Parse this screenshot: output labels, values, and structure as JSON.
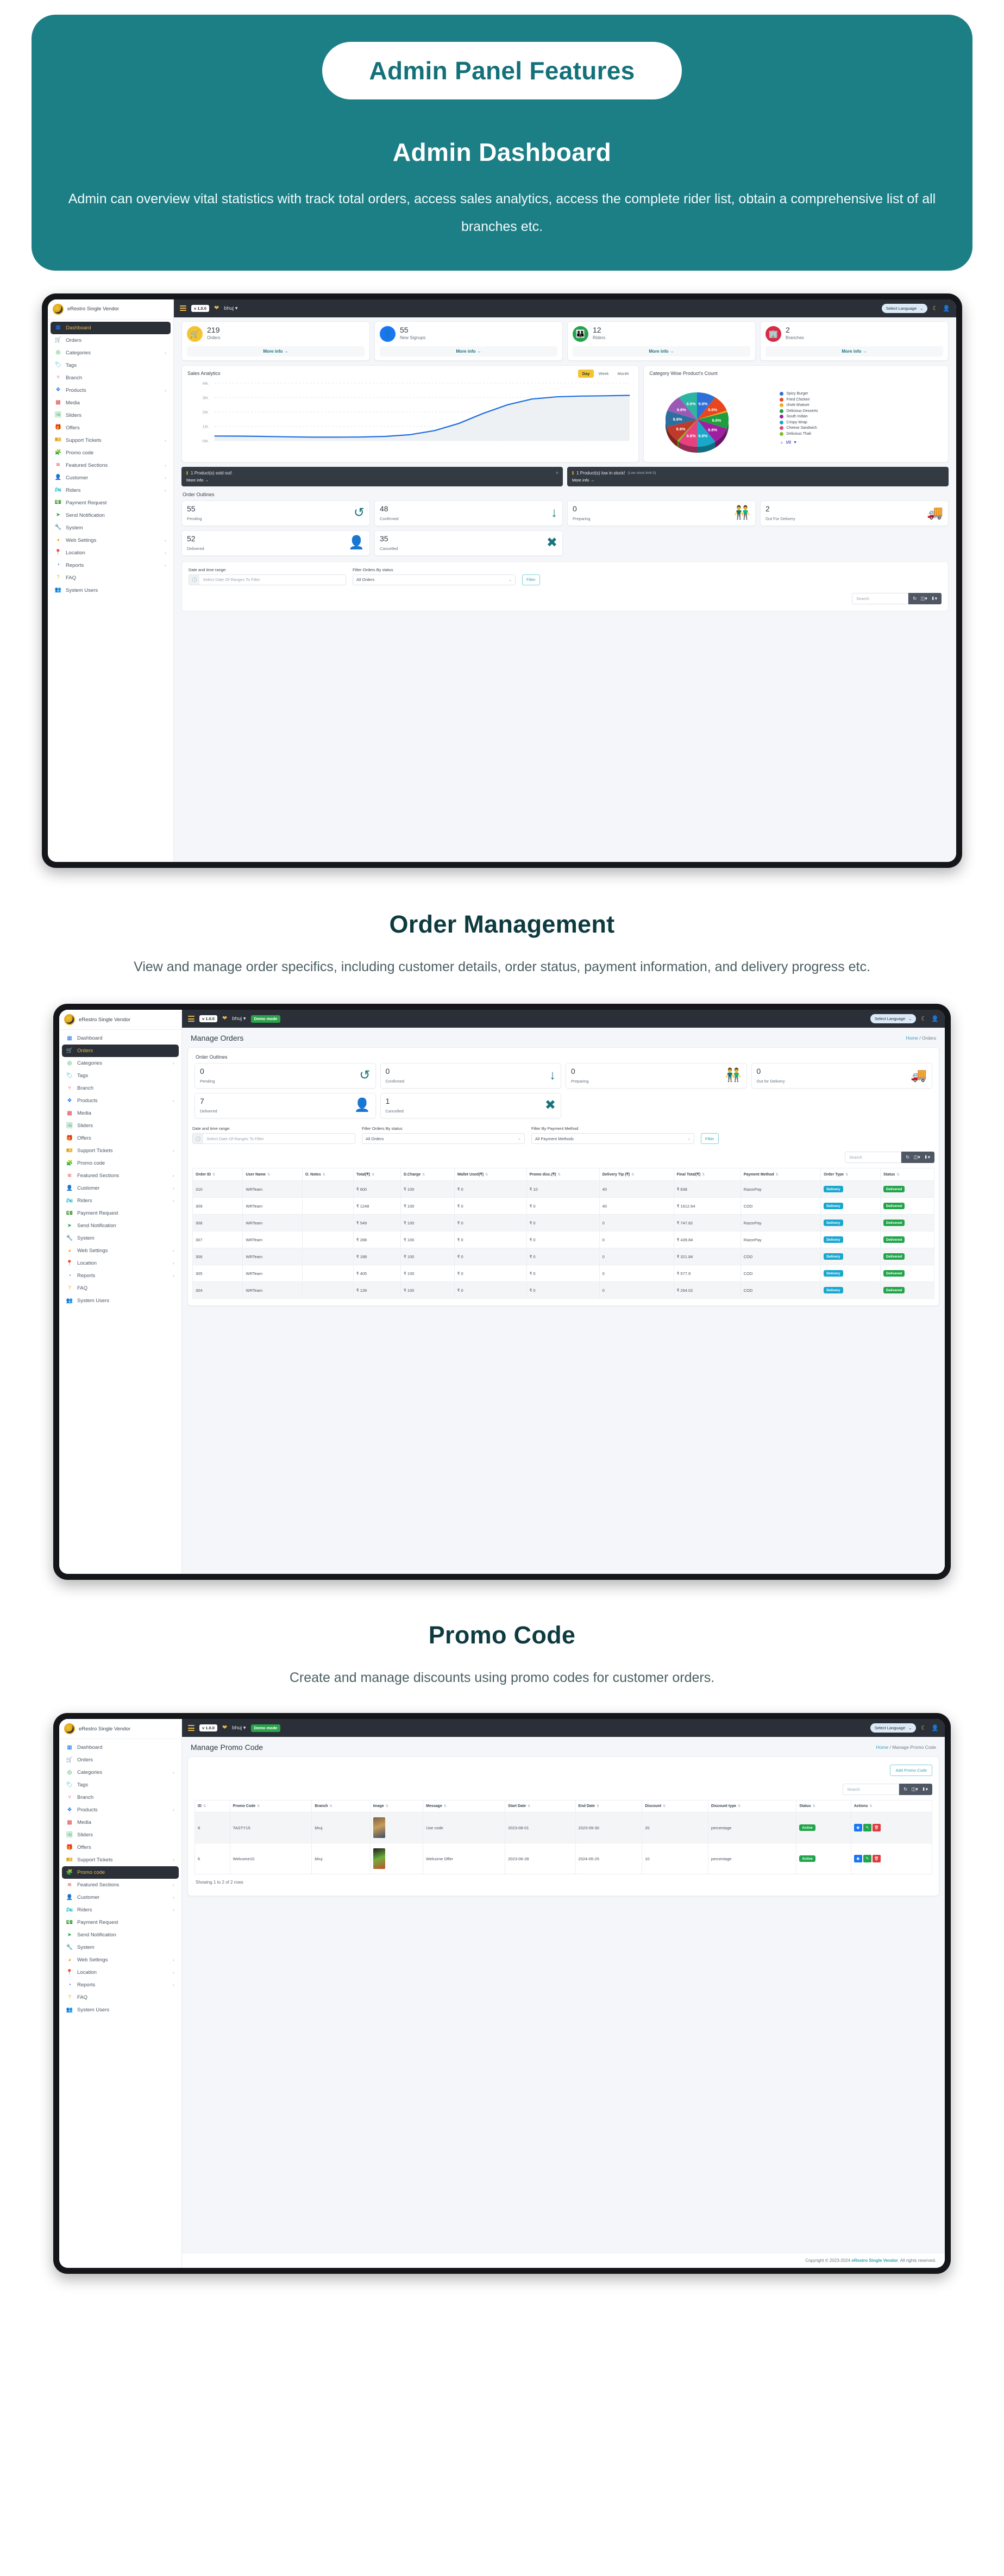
{
  "hero": {
    "pill": "Admin Panel Features",
    "title": "Admin Dashboard",
    "description": "Admin can overview vital statistics with track total orders, access sales analytics, access the complete rider list, obtain a comprehensive list of all branches etc.",
    "bg_color": "#1c7f86",
    "pill_text_color": "#14717a"
  },
  "sections": [
    {
      "title": "Order Management",
      "description": "View and manage order specifics, including customer details, order status, payment information, and delivery progress etc."
    },
    {
      "title": "Promo Code",
      "description": "Create and manage discounts using promo codes for customer orders."
    }
  ],
  "app": {
    "brand": "eRestro Single Vendor",
    "version_chip": "v 1.0.0",
    "user": "bhuj",
    "demo_chip": "Demo mode",
    "language_select": "Select Language",
    "copyright_prefix": "Copyright © 2023-2024 ",
    "copyright_brand": "eRestro Single Vendor",
    "copyright_suffix": ". All rights reserved."
  },
  "sidebar": {
    "items": [
      {
        "label": "Dashboard",
        "icon": "grid-icon",
        "color": "#1877f2",
        "glyph": "▦",
        "caret": false
      },
      {
        "label": "Orders",
        "icon": "cart-icon",
        "color": "#f4a81d",
        "glyph": "🛒",
        "caret": false
      },
      {
        "label": "Categories",
        "icon": "target-icon",
        "color": "#22a44b",
        "glyph": "◎",
        "caret": true
      },
      {
        "label": "Tags",
        "icon": "tag-icon",
        "color": "#17b8c4",
        "glyph": "🏷",
        "caret": false
      },
      {
        "label": "Branch",
        "icon": "branch-icon",
        "color": "#e03a3e",
        "glyph": "⑂",
        "caret": false
      },
      {
        "label": "Products",
        "icon": "products-icon",
        "color": "#1877f2",
        "glyph": "❖",
        "caret": true
      },
      {
        "label": "Media",
        "icon": "media-icon",
        "color": "#e03a3e",
        "glyph": "▩",
        "caret": false
      },
      {
        "label": "Sliders",
        "icon": "image-icon",
        "color": "#22a44b",
        "glyph": "🖼",
        "caret": false
      },
      {
        "label": "Offers",
        "icon": "gift-icon",
        "color": "#1877f2",
        "glyph": "🎁",
        "caret": false
      },
      {
        "label": "Support Tickets",
        "icon": "ticket-icon",
        "color": "#e03a3e",
        "glyph": "🎫",
        "caret": true
      },
      {
        "label": "Promo code",
        "icon": "puzzle-icon",
        "color": "#f4a81d",
        "glyph": "🧩",
        "caret": false
      },
      {
        "label": "Featured Sections",
        "icon": "layers-icon",
        "color": "#e03a3e",
        "glyph": "≋",
        "caret": true
      },
      {
        "label": "Customer",
        "icon": "user-icon",
        "color": "#22a44b",
        "glyph": "👤",
        "caret": true
      },
      {
        "label": "Riders",
        "icon": "motorbike-icon",
        "color": "#17b8c4",
        "glyph": "🏍",
        "caret": true
      },
      {
        "label": "Payment Request",
        "icon": "money-icon",
        "color": "#e03a3e",
        "glyph": "💵",
        "caret": false
      },
      {
        "label": "Send Notification",
        "icon": "send-icon",
        "color": "#22a44b",
        "glyph": "➤",
        "caret": false
      },
      {
        "label": "System",
        "icon": "wrench-icon",
        "color": "#1877f2",
        "glyph": "🔧",
        "caret": false
      },
      {
        "label": "Web Settings",
        "icon": "globe-settings-icon",
        "color": "#f4a81d",
        "glyph": "◕",
        "caret": true
      },
      {
        "label": "Location",
        "icon": "map-pin-icon",
        "color": "#e03a3e",
        "glyph": "📍",
        "caret": true
      },
      {
        "label": "Reports",
        "icon": "pie-report-icon",
        "color": "#1877f2",
        "glyph": "◔",
        "caret": true
      },
      {
        "label": "FAQ",
        "icon": "question-icon",
        "color": "#f4a81d",
        "glyph": "?",
        "caret": false
      },
      {
        "label": "System Users",
        "icon": "system-users-icon",
        "color": "#e03a3e",
        "glyph": "👥",
        "caret": false
      }
    ]
  },
  "dashboard": {
    "active_nav": "Dashboard",
    "stats": [
      {
        "value": "219",
        "label": "Orders",
        "more": "More info",
        "color": "#f4c430",
        "icon": "cart-icon"
      },
      {
        "value": "55",
        "label": "New Signups",
        "more": "More info",
        "color": "#1877f2",
        "icon": "signup-icon"
      },
      {
        "value": "12",
        "label": "Riders",
        "more": "More info",
        "color": "#22a44b",
        "icon": "riders-icon"
      },
      {
        "value": "2",
        "label": "Branches",
        "more": "More info",
        "color": "#d62d46",
        "icon": "branches-icon"
      }
    ],
    "sales_analytics": {
      "panel_title": "Sales Analytics",
      "tabs": [
        "Day",
        "Week",
        "Month"
      ],
      "active_tab": "Day"
    },
    "alerts": [
      {
        "text": "1 Product(s) sold out!",
        "note": "",
        "more": "More info",
        "dismissible": true
      },
      {
        "text": "1 Product(s) low in stock!",
        "note": "(Low stock limit 5)",
        "more": "More info",
        "dismissible": false
      }
    ],
    "order_outlines_title": "Order Outlines",
    "order_outlines": [
      {
        "value": "55",
        "label": "Pending",
        "icon": "clock-rewind-icon"
      },
      {
        "value": "48",
        "label": "Confirmed",
        "icon": "down-arrow-icon"
      },
      {
        "value": "0",
        "label": "Preparing",
        "icon": "handoff-icon"
      },
      {
        "value": "2",
        "label": "Out For Delivery",
        "icon": "truck-icon"
      },
      {
        "value": "52",
        "label": "Delivered",
        "icon": "user-check-icon"
      },
      {
        "value": "35",
        "label": "Cancelled",
        "icon": "cancel-x-icon"
      }
    ],
    "filters": {
      "date_label": "Date and time range:",
      "date_placeholder": "Select Date Of Ranges To Filter",
      "status_label": "Filter Orders By status",
      "status_value": "All Orders",
      "filter_button": "Filter"
    },
    "search_placeholder": "Search"
  },
  "chart_data": [
    {
      "type": "line",
      "title": "Sales Analytics",
      "xlabel": "",
      "ylabel": "",
      "ylim": [
        0,
        4000
      ],
      "ytick_labels": [
        "0K",
        "1K",
        "2K",
        "3K",
        "4K"
      ],
      "ytick_values": [
        0,
        1000,
        2000,
        3000,
        4000
      ],
      "grid": true,
      "legend": "none",
      "series": [
        {
          "name": "Sales",
          "color": "#1f6fe0",
          "x": [
            0,
            1,
            2,
            3,
            4,
            5,
            6,
            7,
            8,
            9,
            10,
            11,
            12,
            13,
            14,
            15,
            16,
            17
          ],
          "values": [
            330,
            320,
            300,
            270,
            250,
            250,
            260,
            300,
            420,
            700,
            1200,
            1900,
            2500,
            2900,
            3050,
            3100,
            3120,
            3150
          ]
        }
      ]
    },
    {
      "type": "pie",
      "title": "Category Wise Product's Count",
      "legend": "right",
      "pager": "1/2",
      "labels": [
        "Spicy Burger",
        "Fried Chicken",
        "chole bhature",
        "Delicious Desserts",
        "South Indian",
        "Crispy Wrap",
        "Cheese Sandwich",
        "Delicious Thali"
      ],
      "colors": [
        "#2f6fd8",
        "#e8461e",
        "#f5a623",
        "#1f9e3f",
        "#a01fa0",
        "#18a8c8",
        "#e8417f",
        "#7fbf1f"
      ],
      "values": [
        9.8,
        9.8,
        1.0,
        9.8,
        9.8,
        9.8,
        9.8,
        1.0
      ],
      "slice_labels": [
        "9.8%",
        "9.8%",
        "",
        "9.8%",
        "9.8%",
        "9.8%",
        "9.8%",
        ""
      ],
      "extra_colors": [
        "#c0392b",
        "#2c6f9e",
        "#9b59b6",
        "#2cb5a0"
      ],
      "extra_labels": [
        "9.8%",
        "9.8%",
        "9.8%",
        "9.8%"
      ]
    }
  ],
  "orders_page": {
    "active_nav": "Orders",
    "page_title": "Manage Orders",
    "breadcrumb_home": "Home",
    "breadcrumb_sep": " / ",
    "breadcrumb_current": "Orders",
    "order_outlines_title": "Order Outlines",
    "order_outlines": [
      {
        "value": "0",
        "label": "Pending",
        "icon": "clock-rewind-icon"
      },
      {
        "value": "0",
        "label": "Confirmed",
        "icon": "down-arrow-icon"
      },
      {
        "value": "0",
        "label": "Preparing",
        "icon": "handoff-icon"
      },
      {
        "value": "0",
        "label": "Out for Delivery",
        "icon": "truck-icon"
      },
      {
        "value": "7",
        "label": "Delivered",
        "icon": "user-check-icon"
      },
      {
        "value": "1",
        "label": "Cancelled",
        "icon": "cancel-x-icon"
      }
    ],
    "filters": {
      "date_label": "Date and time range:",
      "date_placeholder": "Select Date Of Ranges To Filter",
      "status_label": "Filter Orders By status",
      "status_value": "All Orders",
      "payment_label": "Filter By Payment Method",
      "payment_value": "All Payment Methods",
      "filter_button": "Filter"
    },
    "search_placeholder": "Search",
    "columns": [
      "Order ID",
      "User Name",
      "O. Notes",
      "Total(₹)",
      "D.Charge",
      "Wallet Used(₹)",
      "Promo disc.(₹)",
      "Delivery Tip (₹)",
      "Final Total(₹)",
      "Payment Method",
      "Order Type",
      "Status"
    ],
    "rows": [
      {
        "order_id": "310",
        "user_name": "WRTeam",
        "notes": "",
        "total": "₹ 600",
        "dcharge": "₹ 100",
        "wallet": "₹ 0",
        "promo": "₹ 10",
        "tip": "40",
        "final": "₹ 838",
        "payment": "RazorPay",
        "type": "Delivery",
        "status": "Delivered"
      },
      {
        "order_id": "309",
        "user_name": "WRTeam",
        "notes": "",
        "total": "₹ 1248",
        "dcharge": "₹ 100",
        "wallet": "₹ 0",
        "promo": "₹ 0",
        "tip": "40",
        "final": "₹ 1612.64",
        "payment": "COD",
        "type": "Delivery",
        "status": "Delivered"
      },
      {
        "order_id": "308",
        "user_name": "WRTeam",
        "notes": "",
        "total": "₹ 549",
        "dcharge": "₹ 100",
        "wallet": "₹ 0",
        "promo": "₹ 0",
        "tip": "0",
        "final": "₹ 747.82",
        "payment": "RazorPay",
        "type": "Delivery",
        "status": "Delivered"
      },
      {
        "order_id": "307",
        "user_name": "WRTeam",
        "notes": "",
        "total": "₹ 288",
        "dcharge": "₹ 100",
        "wallet": "₹ 0",
        "promo": "₹ 0",
        "tip": "0",
        "final": "₹ 439.84",
        "payment": "RazorPay",
        "type": "Delivery",
        "status": "Delivered"
      },
      {
        "order_id": "306",
        "user_name": "WRTeam",
        "notes": "",
        "total": "₹ 188",
        "dcharge": "₹ 100",
        "wallet": "₹ 0",
        "promo": "₹ 0",
        "tip": "0",
        "final": "₹ 321.84",
        "payment": "COD",
        "type": "Delivery",
        "status": "Delivered"
      },
      {
        "order_id": "305",
        "user_name": "WRTeam",
        "notes": "",
        "total": "₹ 405",
        "dcharge": "₹ 100",
        "wallet": "₹ 0",
        "promo": "₹ 0",
        "tip": "0",
        "final": "₹ 577.9",
        "payment": "COD",
        "type": "Delivery",
        "status": "Delivered"
      },
      {
        "order_id": "304",
        "user_name": "WRTeam",
        "notes": "",
        "total": "₹ 139",
        "dcharge": "₹ 100",
        "wallet": "₹ 0",
        "promo": "₹ 0",
        "tip": "0",
        "final": "₹ 264.02",
        "payment": "COD",
        "type": "Delivery",
        "status": "Delivered"
      }
    ]
  },
  "promo_page": {
    "active_nav": "Promo code",
    "page_title": "Manage Promo Code",
    "breadcrumb_home": "Home",
    "breadcrumb_sep": " / ",
    "breadcrumb_current": "Manage Promo Code",
    "add_button": "Add Promo Code",
    "search_placeholder": "Search",
    "columns": [
      "ID",
      "Promo Code",
      "Branch",
      "Image",
      "Message",
      "Start Date",
      "End Date",
      "Discount",
      "Discount type",
      "Status",
      "Actions"
    ],
    "rows": [
      {
        "id": "8",
        "code": "TASTY15",
        "branch": "bhuj",
        "message": "Use code",
        "start": "2023-08-01",
        "end": "2023-09-30",
        "discount": "20",
        "dtype": "percentage",
        "status": "Active",
        "actions": [
          "view",
          "edit",
          "delete"
        ]
      },
      {
        "id": "6",
        "code": "Welcome10",
        "branch": "bhuj",
        "message": "Welcome Offer",
        "start": "2023-06-28",
        "end": "2024-05-25",
        "discount": "10",
        "dtype": "percentage",
        "status": "Active",
        "actions": [
          "view",
          "edit",
          "delete"
        ]
      }
    ],
    "rows_info": "Showing 1 to 2 of 2 rows"
  }
}
